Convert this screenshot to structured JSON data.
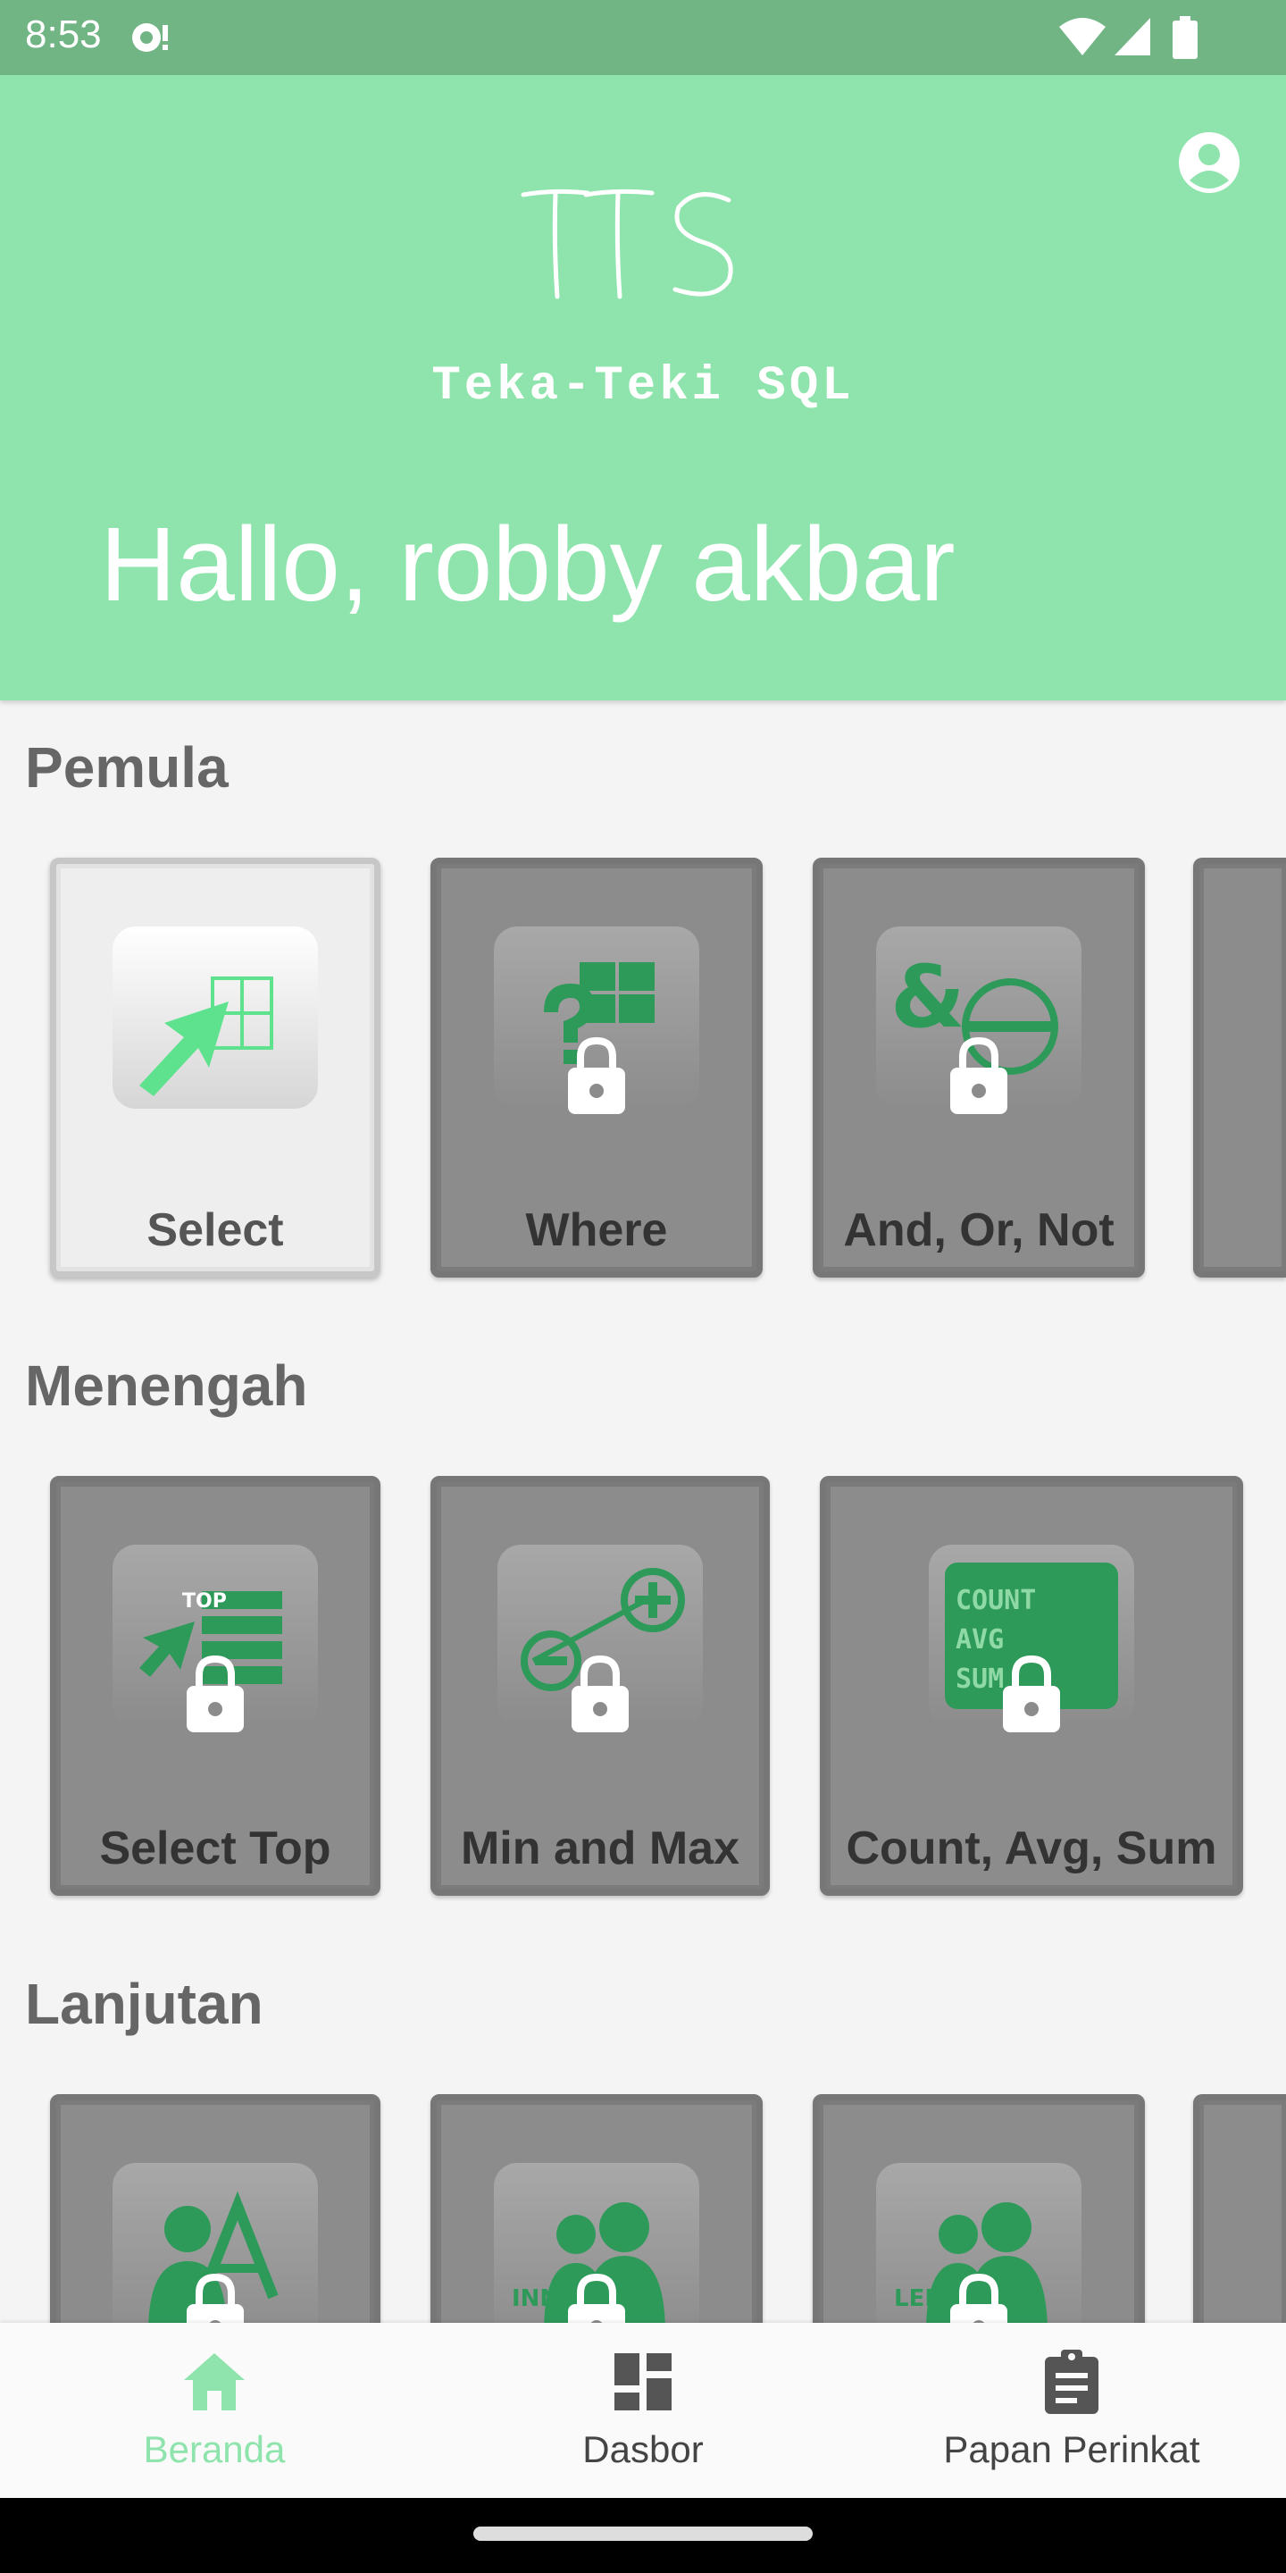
{
  "status_bar": {
    "time": "8:53"
  },
  "header": {
    "logo_text": "TTS",
    "subtitle": "Teka-Teki SQL",
    "greeting": "Hallo, robby akbar"
  },
  "sections": [
    {
      "title": "Pemula",
      "cards": [
        {
          "label": "Select",
          "locked": false,
          "icon": "select-arrow-grid-icon"
        },
        {
          "label": "Where",
          "locked": true,
          "icon": "question-grid-icon"
        },
        {
          "label": "And, Or, Not",
          "locked": true,
          "icon": "ampersand-circle-icon"
        }
      ]
    },
    {
      "title": "Menengah",
      "cards": [
        {
          "label": "Select Top",
          "locked": true,
          "icon": "select-top-icon"
        },
        {
          "label": "Min and Max",
          "locked": true,
          "icon": "min-max-icon"
        },
        {
          "label": "Count, Avg, Sum",
          "locked": true,
          "icon": "count-avg-sum-icon"
        }
      ]
    },
    {
      "title": "Lanjutan",
      "cards": [
        {
          "label": "",
          "locked": true,
          "icon": "person-a-icon"
        },
        {
          "label": "",
          "locked": true,
          "icon": "inner-join-people-icon"
        },
        {
          "label": "",
          "locked": true,
          "icon": "left-join-people-icon"
        }
      ]
    }
  ],
  "tile_texts": {
    "select_top": "TOP",
    "count": "COUNT",
    "avg": "AVG",
    "sum": "SUM",
    "inner": "INNER",
    "left": "LEFT"
  },
  "bottom_nav": [
    {
      "label": "Beranda",
      "icon": "home-icon",
      "active": true
    },
    {
      "label": "Dasbor",
      "icon": "dashboard-icon",
      "active": false
    },
    {
      "label": "Papan Perinkat",
      "icon": "clipboard-icon",
      "active": false
    }
  ],
  "colors": {
    "accent": "#8ee4ac",
    "status_bar": "#71b584",
    "icon_green": "#2e9a5a",
    "locked_card": "#8c8c8c"
  }
}
